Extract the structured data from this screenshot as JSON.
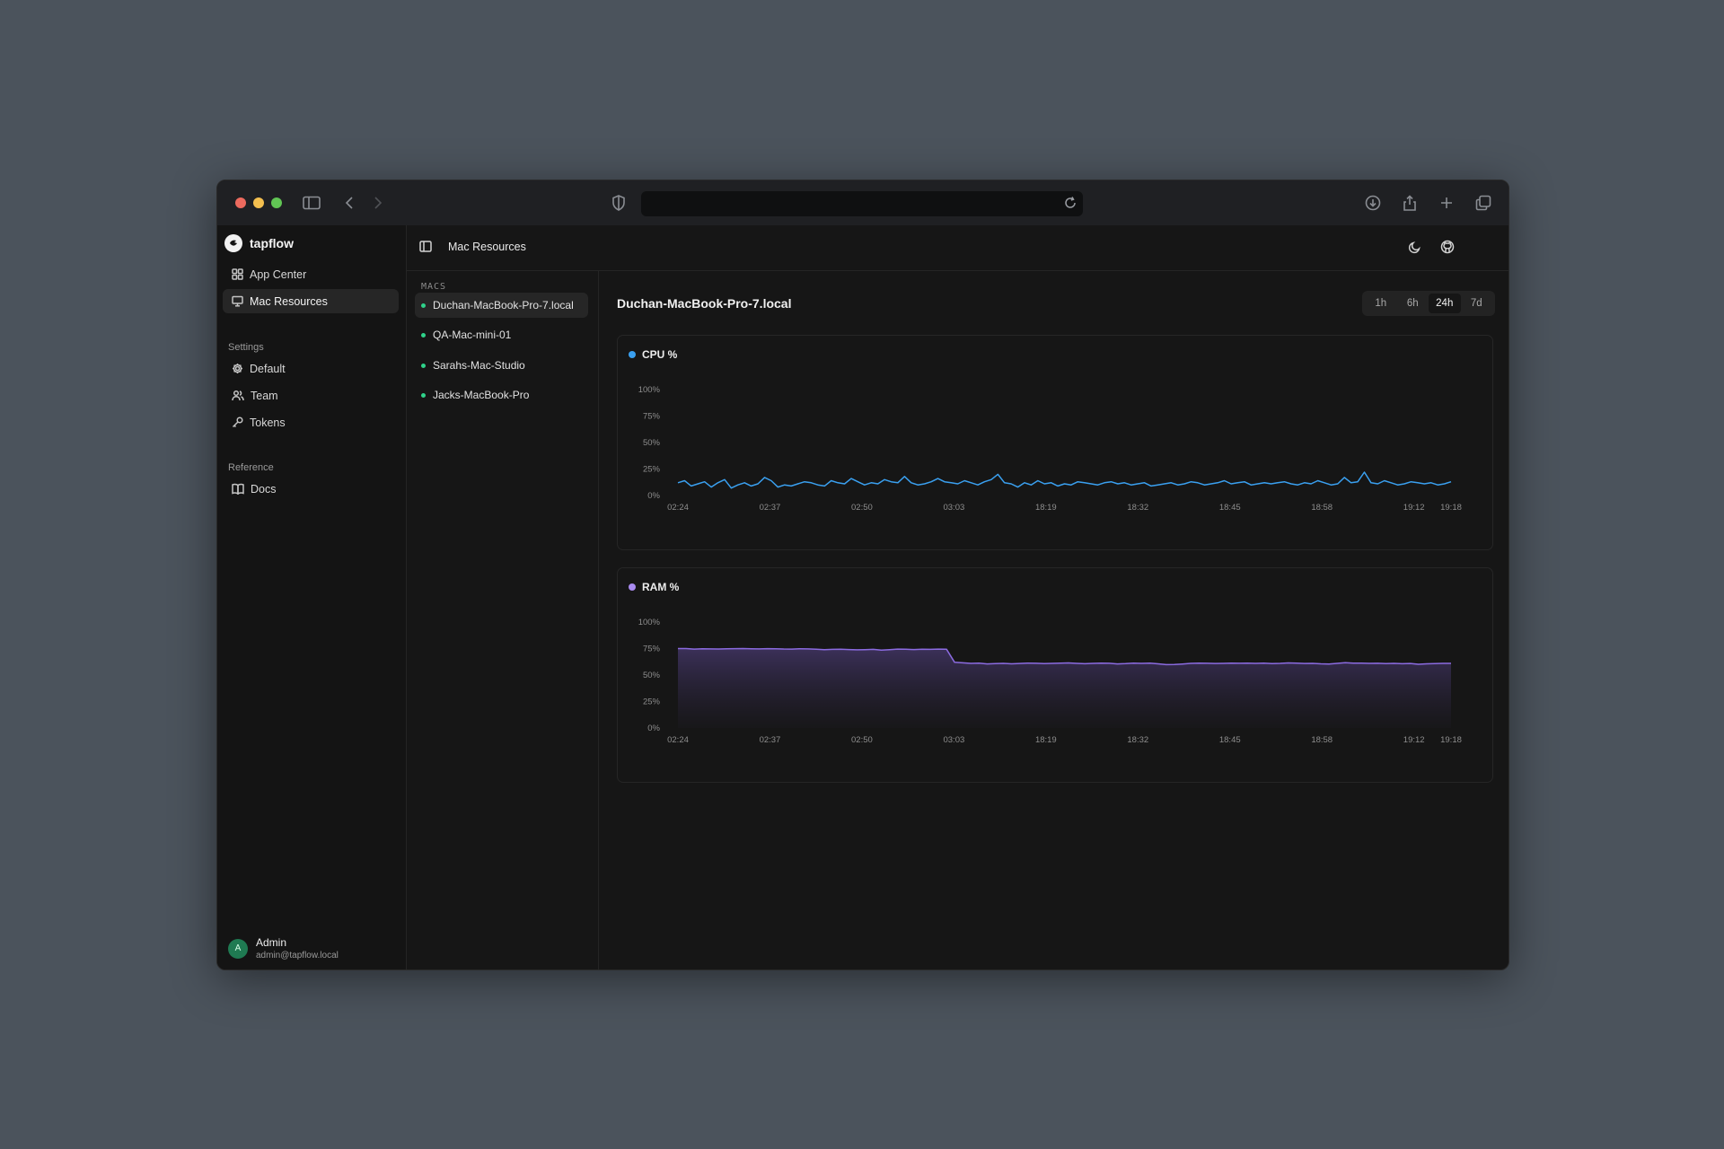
{
  "colors": {
    "cpu_line": "#3aa0f0",
    "ram_line": "#8b6be0",
    "status_online": "#2fd28a",
    "avatar_bg": "#1f7a52"
  },
  "browser": {
    "icons": [
      "sidebar-toggle-icon",
      "back-icon",
      "forward-icon",
      "shield-icon",
      "reload-icon",
      "download-icon",
      "share-icon",
      "plus-icon",
      "tabs-icon"
    ]
  },
  "sidebar": {
    "brand": "tapflow",
    "items": [
      {
        "label": "App Center",
        "icon": "grid-icon"
      },
      {
        "label": "Mac Resources",
        "icon": "monitor-icon",
        "active": true
      }
    ],
    "settings_label": "Settings",
    "settings_items": [
      {
        "label": "Default",
        "icon": "gear-icon"
      },
      {
        "label": "Team",
        "icon": "users-icon"
      },
      {
        "label": "Tokens",
        "icon": "key-icon"
      }
    ],
    "reference_label": "Reference",
    "reference_items": [
      {
        "label": "Docs",
        "icon": "book-icon"
      }
    ],
    "user": {
      "initial": "A",
      "name": "Admin",
      "email": "admin@tapflow.local"
    }
  },
  "topbar": {
    "title": "Mac Resources"
  },
  "macs": {
    "label": "MACS",
    "items": [
      {
        "name": "Duchan-MacBook-Pro-7.local",
        "active": true
      },
      {
        "name": "QA-Mac-mini-01"
      },
      {
        "name": "Sarahs-Mac-Studio"
      },
      {
        "name": "Jacks-MacBook-Pro"
      }
    ]
  },
  "main": {
    "host": "Duchan-MacBook-Pro-7.local",
    "ranges": [
      "1h",
      "6h",
      "24h",
      "7d"
    ],
    "active_range": "24h"
  },
  "chart_data": [
    {
      "type": "line",
      "title": "CPU %",
      "ylim": [
        0,
        100
      ],
      "yticks": [
        "100%",
        "75%",
        "50%",
        "25%",
        "0%"
      ],
      "xticks": [
        "02:24",
        "02:37",
        "02:50",
        "03:03",
        "18:19",
        "18:32",
        "18:45",
        "18:58",
        "19:12",
        "19:18"
      ],
      "values": [
        12,
        14,
        9,
        11,
        13,
        8,
        12,
        15,
        7,
        10,
        12,
        9,
        11,
        17,
        14,
        8,
        10,
        9,
        11,
        13,
        12,
        10,
        9,
        14,
        12,
        11,
        16,
        13,
        10,
        12,
        11,
        15,
        13,
        12,
        18,
        12,
        10,
        11,
        13,
        16,
        13,
        12,
        11,
        14,
        12,
        10,
        13,
        15,
        20,
        12,
        11,
        8,
        12,
        10,
        14,
        11,
        12,
        9,
        11,
        10,
        13,
        12,
        11,
        10,
        12,
        13,
        11,
        12,
        10,
        11,
        12,
        9,
        10,
        11,
        12,
        10,
        11,
        13,
        12,
        10,
        11,
        12,
        14,
        11,
        12,
        13,
        10,
        11,
        12,
        11,
        12,
        13,
        11,
        10,
        12,
        11,
        14,
        12,
        10,
        11,
        17,
        12,
        13,
        22,
        12,
        11,
        14,
        12,
        10,
        11,
        13,
        12,
        11,
        12,
        10,
        11,
        13
      ],
      "grid": false
    },
    {
      "type": "area",
      "title": "RAM %",
      "ylim": [
        0,
        100
      ],
      "yticks": [
        "100%",
        "75%",
        "50%",
        "25%",
        "0%"
      ],
      "xticks": [
        "02:24",
        "02:37",
        "02:50",
        "03:03",
        "18:19",
        "18:32",
        "18:45",
        "18:58",
        "19:12",
        "19:18"
      ],
      "values": [
        75,
        75,
        74.5,
        74.8,
        74.7,
        74.6,
        74.8,
        74.9,
        75,
        74.8,
        74.7,
        74.9,
        74.8,
        74.6,
        74.5,
        74.8,
        74.7,
        74.3,
        74,
        74.2,
        74.4,
        74.1,
        73.8,
        74,
        74.2,
        73.5,
        74,
        74.5,
        74.3,
        74.1,
        74.4,
        74.2,
        74.5,
        74.4,
        62,
        61.5,
        61,
        61.2,
        60.5,
        60.8,
        61,
        60.6,
        60.9,
        61.3,
        61.1,
        60.8,
        61,
        61.2,
        61.4,
        61,
        60.7,
        61,
        61.2,
        61.1,
        60.5,
        60.8,
        61.3,
        61,
        61.2,
        60.6,
        59.8,
        60,
        60.4,
        61,
        61.2,
        61.1,
        60.9,
        61,
        61.2,
        61.1,
        61.3,
        61,
        61.2,
        60.8,
        61,
        61.4,
        61.2,
        60.9,
        61,
        60.6,
        60.4,
        61,
        61.6,
        61.3,
        61.2,
        61,
        61.1,
        60.8,
        61,
        60.7,
        60.9,
        60.2,
        60.6,
        60.8,
        61,
        61
      ],
      "grid": false
    }
  ]
}
